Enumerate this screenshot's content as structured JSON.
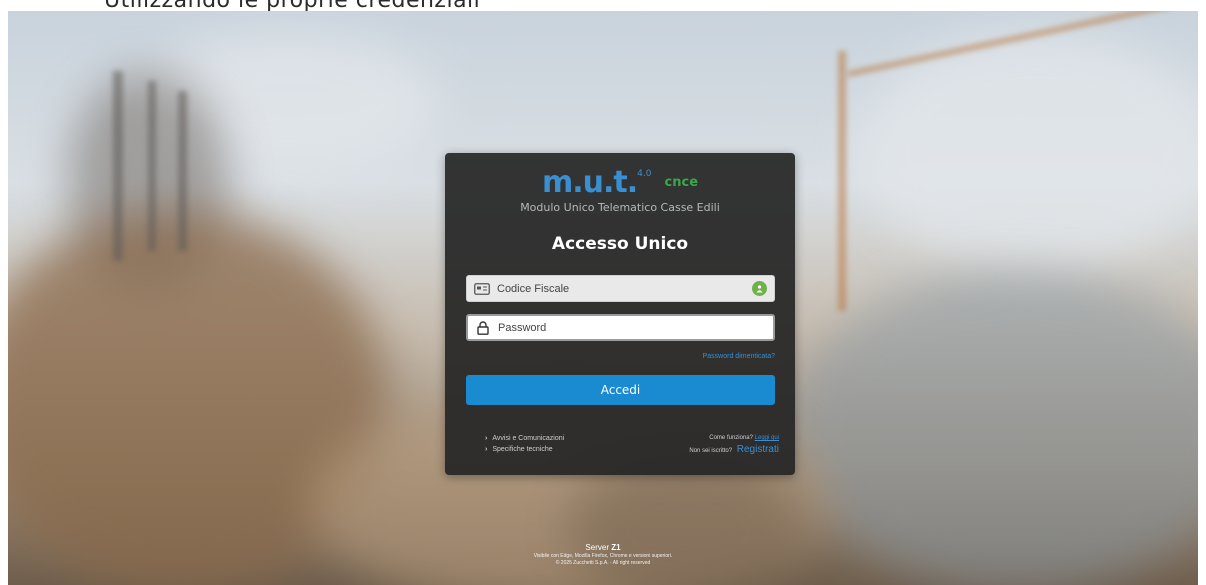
{
  "caption": "Utilizzando le proprie credenziali",
  "login": {
    "logo_main": "m.u.t.",
    "logo_version": "4.0",
    "logo_partner": "cnce",
    "subtitle": "Modulo Unico Telematico Casse Edili",
    "title": "Accesso Unico",
    "codice_fiscale_placeholder": "Codice Fiscale",
    "password_placeholder": "Password",
    "forgot_password": "Password dimenticata?",
    "submit_label": "Accedi",
    "links": [
      {
        "label": "Avvisi e Comunicazioni"
      },
      {
        "label": "Specifiche tecniche"
      }
    ],
    "how_it_works_text": "Come funziona?",
    "how_it_works_link": "Leggi qui",
    "not_registered_text": "Non sei iscritto?",
    "register_link": "Registrati"
  },
  "footer": {
    "server_label": "Server",
    "server_id": "Z1",
    "browsers": "Visibile con Edge, Mozilla Firefox, Chrome e versioni superiori.",
    "copyright": "© 2025 Zucchetti S.p.A. - All right reserved"
  },
  "colors": {
    "accent": "#1a8bd0",
    "card_bg": "#262626",
    "brand_green": "#3aa84a"
  }
}
